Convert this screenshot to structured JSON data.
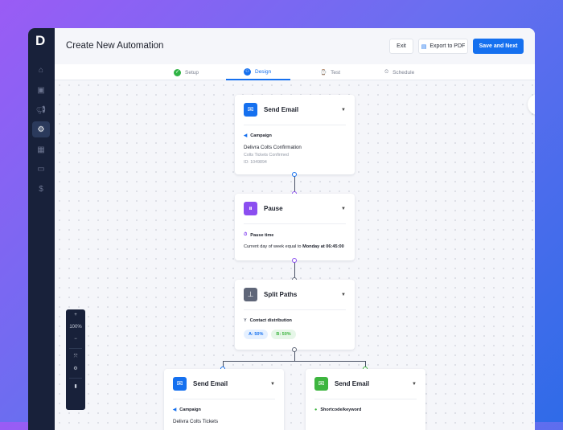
{
  "header": {
    "title": "Create New Automation",
    "exit": "Exit",
    "export": "Export to PDF",
    "save": "Save and Next"
  },
  "tabs": [
    {
      "label": "Setup"
    },
    {
      "label": "Design"
    },
    {
      "label": "Test"
    },
    {
      "label": "Schedule"
    }
  ],
  "sidebar": {
    "logo": "D",
    "items": [
      "home",
      "calendar",
      "megaphone",
      "automation",
      "reports",
      "gallery",
      "billing"
    ]
  },
  "zoom": {
    "level": "100%",
    "in": "+",
    "out": "−"
  },
  "nodes": {
    "email1": {
      "title": "Send Email",
      "section": "Campaign",
      "name": "Delivra Colts Confirmation",
      "subject": "Colts Tickets Confirmed",
      "id": "ID: 1049894"
    },
    "pause": {
      "title": "Pause",
      "section": "Pause time",
      "text": "Current day of week equal to ",
      "bold": "Monday at 06:45:00"
    },
    "split": {
      "title": "Split Paths",
      "section": "Contact distribution",
      "a": "A: 50%",
      "b": "B: 50%"
    },
    "email2": {
      "title": "Send Email",
      "section": "Campaign",
      "name": "Delivra Colts Tickets"
    },
    "email3": {
      "title": "Send Email",
      "section": "Shortcode/keyword"
    }
  },
  "colors": {
    "primary": "#1570ef",
    "purple": "#8b4ef0",
    "gray": "#5f6678",
    "green": "#3db53f"
  }
}
